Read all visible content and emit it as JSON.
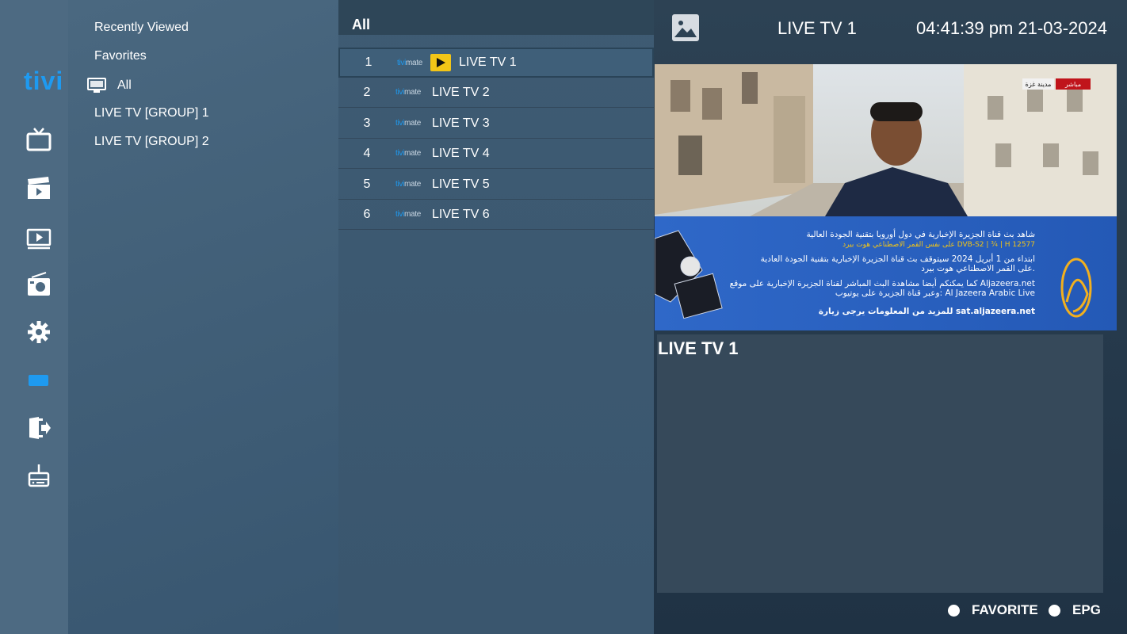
{
  "app": {
    "logo": "tivi"
  },
  "rail_icons": [
    "tv-icon",
    "movies-icon",
    "series-icon",
    "radio-icon",
    "settings-icon",
    "card-icon",
    "exit-icon",
    "router-icon"
  ],
  "categories": {
    "items": [
      {
        "label": "Recently Viewed"
      },
      {
        "label": "Favorites"
      },
      {
        "label": "All",
        "icon": "monitor-icon",
        "selected": true
      },
      {
        "label": "LIVE TV [GROUP] 1"
      },
      {
        "label": "LIVE TV [GROUP] 2"
      }
    ]
  },
  "channel_list": {
    "heading": "All",
    "brand_tag": "tivimate",
    "channels": [
      {
        "number": "1",
        "name": "LIVE TV 1",
        "playing": true
      },
      {
        "number": "2",
        "name": "LIVE TV 2"
      },
      {
        "number": "3",
        "name": "LIVE TV 3"
      },
      {
        "number": "4",
        "name": "LIVE TV 4"
      },
      {
        "number": "5",
        "name": "LIVE TV 5"
      },
      {
        "number": "6",
        "name": "LIVE TV 6"
      }
    ]
  },
  "header": {
    "current_channel": "LIVE TV 1",
    "datetime": "04:41:39 pm 21-03-2024"
  },
  "preview": {
    "banner_lines": [
      "شاهد بث قناة الجزيرة الإخبارية في دول أوروبا بتقنية الجودة العالية",
      "على نفس القمر الاصطناعي هوت بيرد DVB-S2 | ¾ | H 12577",
      "ابتداء من 1 أبريل 2024 سيتوقف بث قناة الجزيرة الإخبارية بتقنية الجودة العادية",
      "على القمر الاصطناعي هوت بيرد.",
      "كما يمكنكم أيضا مشاهدة البث المباشر لقناة الجزيرة الإخبارية على موقع Aljazeera.net",
      "وعبر قناة الجزيرة على يوتيوب: Al Jazeera Arabic Live",
      "للمزيد من المعلومات يرجى زيارة sat.aljazeera.net"
    ],
    "live_badge": "مباشر",
    "location_badge": "مدينة غزة"
  },
  "info": {
    "title": "LIVE TV 1"
  },
  "footer": {
    "favorite": "FAVORITE",
    "epg": "EPG"
  },
  "colors": {
    "accent": "#1e9af0",
    "play": "#f2c517"
  }
}
